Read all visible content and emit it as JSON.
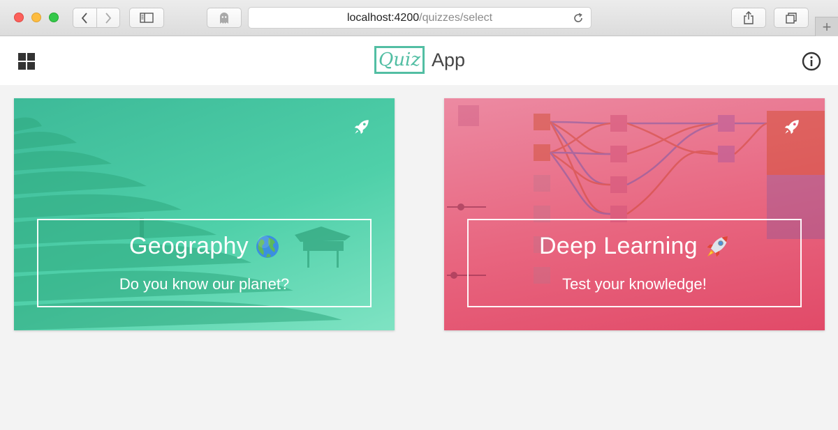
{
  "browser": {
    "url_host": "localhost:4200",
    "url_path": "/quizzes/select"
  },
  "header": {
    "logo_text": "Quiz",
    "app_name": "App",
    "menu_icon": "apps-grid-icon",
    "info_icon": "info-icon"
  },
  "cards": [
    {
      "title": "Geography",
      "emoji": "globe-icon",
      "subtitle": "Do you know our planet?",
      "badge_icon": "rocket-icon",
      "color": "#4cc9a3"
    },
    {
      "title": "Deep Learning",
      "emoji": "rocket-icon",
      "subtitle": "Test your knowledge!",
      "badge_icon": "rocket-icon",
      "color": "#e65a77"
    }
  ]
}
